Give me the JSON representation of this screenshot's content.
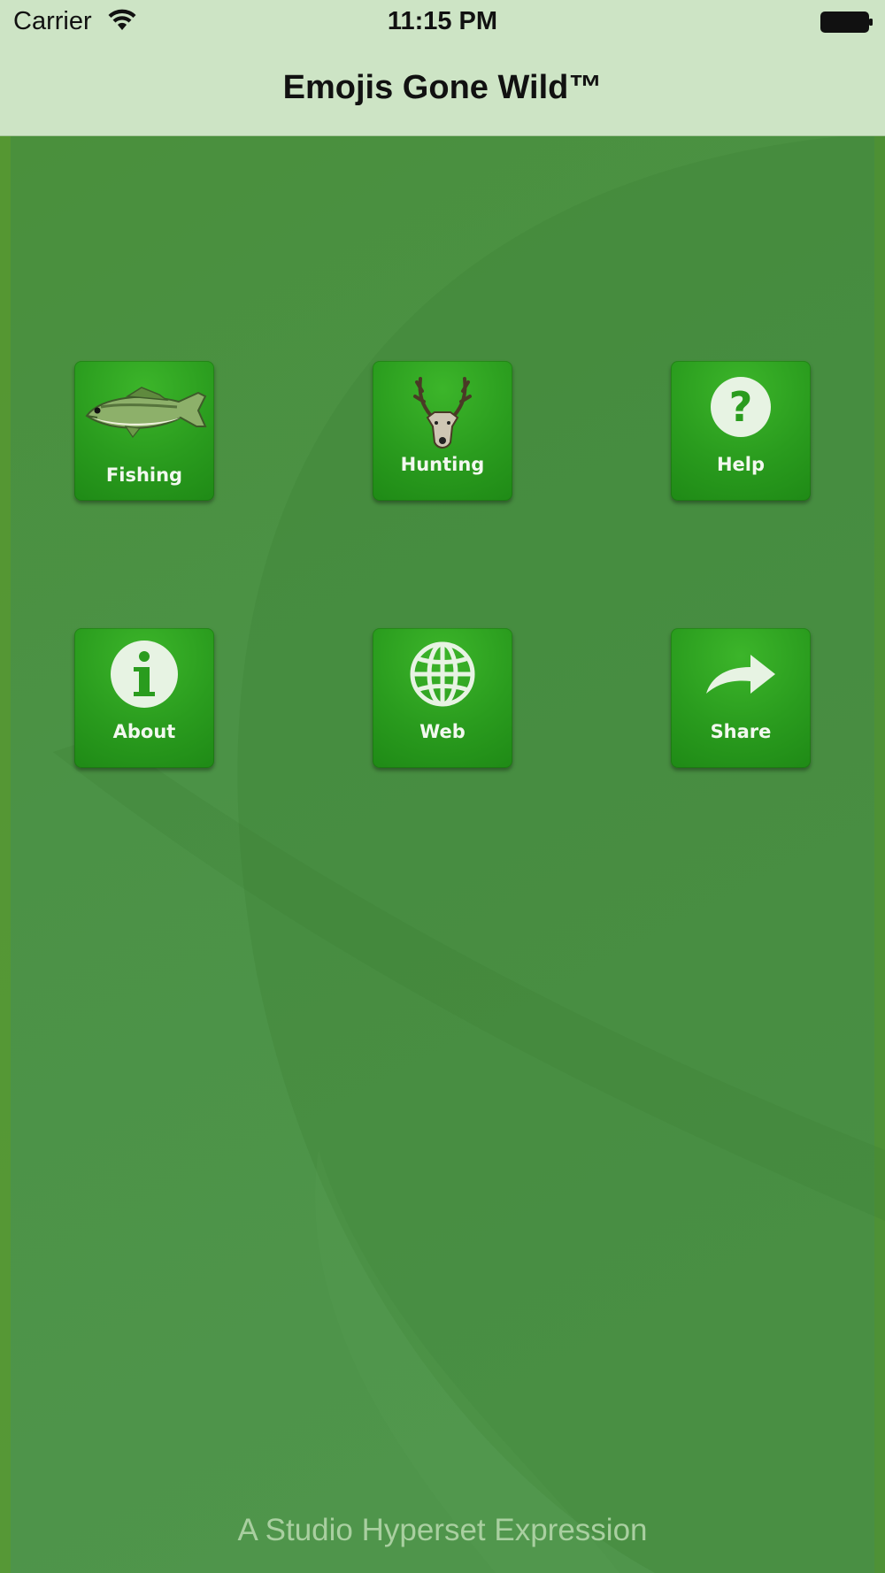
{
  "status_bar": {
    "carrier": "Carrier",
    "time": "11:15 PM",
    "wifi_icon": "wifi-icon",
    "battery_icon": "battery-icon"
  },
  "nav_bar": {
    "title": "Emojis Gone Wild™"
  },
  "tiles": [
    {
      "label": "Fishing",
      "icon": "bass-fish-icon"
    },
    {
      "label": "Hunting",
      "icon": "deer-head-icon"
    },
    {
      "label": "Help",
      "icon": "question-icon"
    },
    {
      "label": "About",
      "icon": "info-icon"
    },
    {
      "label": "Web",
      "icon": "globe-icon"
    },
    {
      "label": "Share",
      "icon": "share-arrow-icon"
    }
  ],
  "footer": {
    "text": "A Studio Hyperset Expression"
  },
  "colors": {
    "nav_background": "#cde4c5",
    "screen_background": "#4a8a3c",
    "tile_green": "#2a9c1e",
    "footer_text": "#a9cfa0"
  }
}
